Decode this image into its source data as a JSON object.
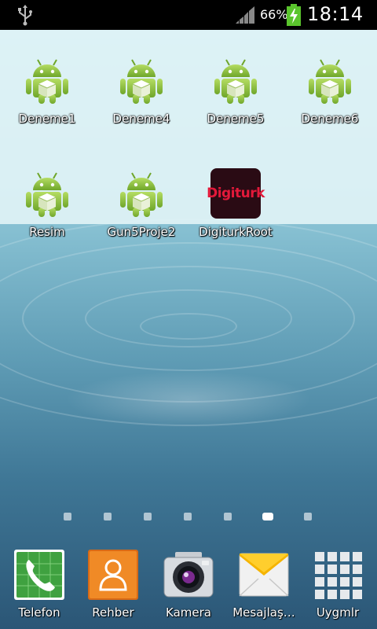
{
  "status_bar": {
    "battery_percent": "66%",
    "time": "18:14",
    "icons": [
      "usb-icon",
      "signal-icon",
      "battery-charging-icon"
    ]
  },
  "home": {
    "apps": [
      {
        "label": "Deneme1",
        "icon": "android-icon"
      },
      {
        "label": "Deneme4",
        "icon": "android-icon"
      },
      {
        "label": "Deneme5",
        "icon": "android-icon"
      },
      {
        "label": "Deneme6",
        "icon": "android-icon"
      },
      {
        "label": "Resim",
        "icon": "android-icon"
      },
      {
        "label": "Gun5Proje2",
        "icon": "android-icon"
      },
      {
        "label": "DigiturkRoot",
        "icon": "digiturk-icon",
        "icon_text": "Digiturk"
      }
    ]
  },
  "pager": {
    "pages": 7,
    "active": 6
  },
  "dock": {
    "items": [
      {
        "label": "Telefon",
        "icon": "phone-icon"
      },
      {
        "label": "Rehber",
        "icon": "contacts-icon"
      },
      {
        "label": "Kamera",
        "icon": "camera-icon"
      },
      {
        "label": "Mesajlaş…",
        "icon": "messages-icon"
      },
      {
        "label": "Uygmlr",
        "icon": "apps-grid-icon"
      }
    ]
  },
  "colors": {
    "status_bar_bg": "#000000",
    "battery_green": "#5ac52d",
    "android_green": "#8cc63f",
    "digiturk_red": "#e3193a"
  }
}
